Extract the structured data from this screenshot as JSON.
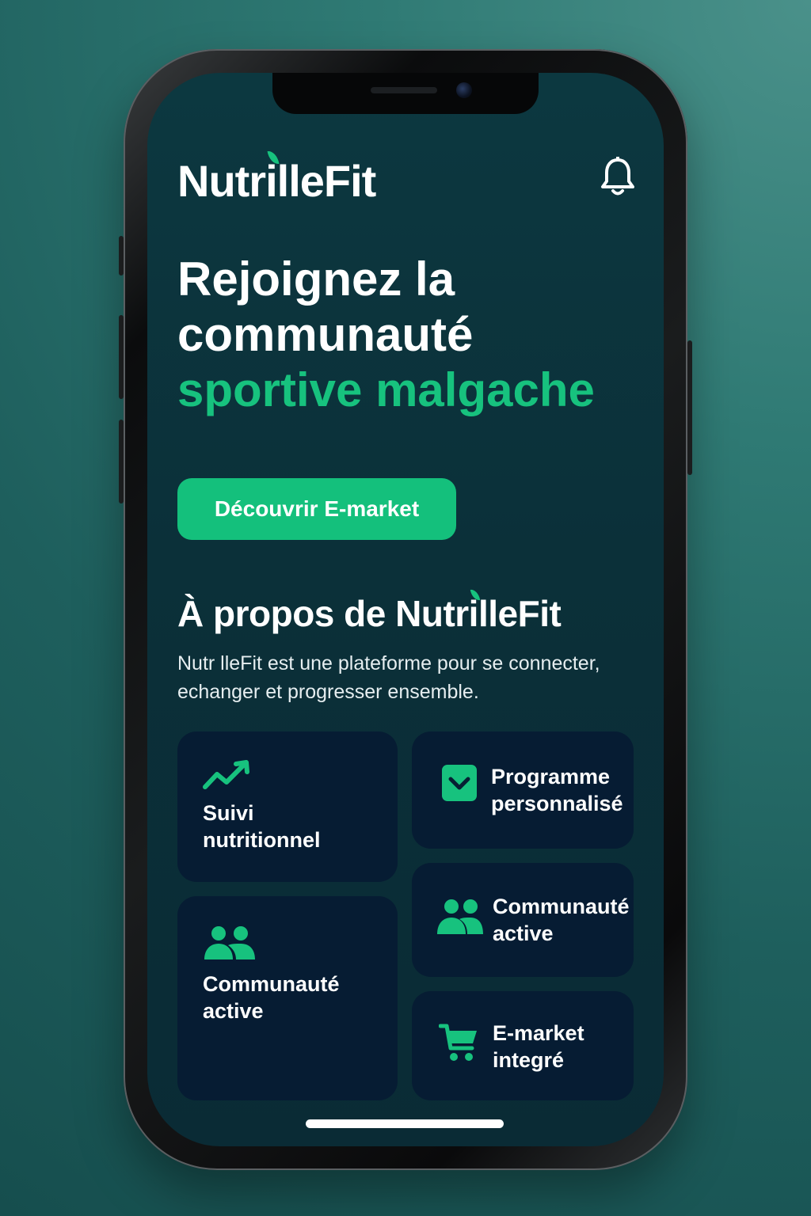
{
  "app": {
    "brand_prefix": "Nutr",
    "brand_leaf": "i",
    "brand_suffix": "lleFit"
  },
  "hero": {
    "line1": "Rejoignez la",
    "line2": "communauté",
    "accent": "sportive malgache"
  },
  "cta": {
    "label": "Découvrir E-market"
  },
  "about": {
    "title_prefix": "À propos de Nutr",
    "title_leaf": "i",
    "title_suffix": "lleFit",
    "text": "Nutr lleFit est une plateforme pour se connecter, echanger et progresser ensemble."
  },
  "features": [
    {
      "label": "Suivi nutritionnel",
      "icon": "trend-up-icon"
    },
    {
      "label": "Programme personnalisé",
      "icon": "check-square-icon"
    },
    {
      "label": "Communauté active",
      "icon": "community-icon"
    },
    {
      "label": "Communauté active",
      "icon": "community-icon"
    },
    {
      "label": "E-market integré",
      "icon": "cart-icon"
    }
  ],
  "colors": {
    "accent": "#17c27e",
    "screen_bg": "#0b3039",
    "card_bg": "#061c33"
  }
}
